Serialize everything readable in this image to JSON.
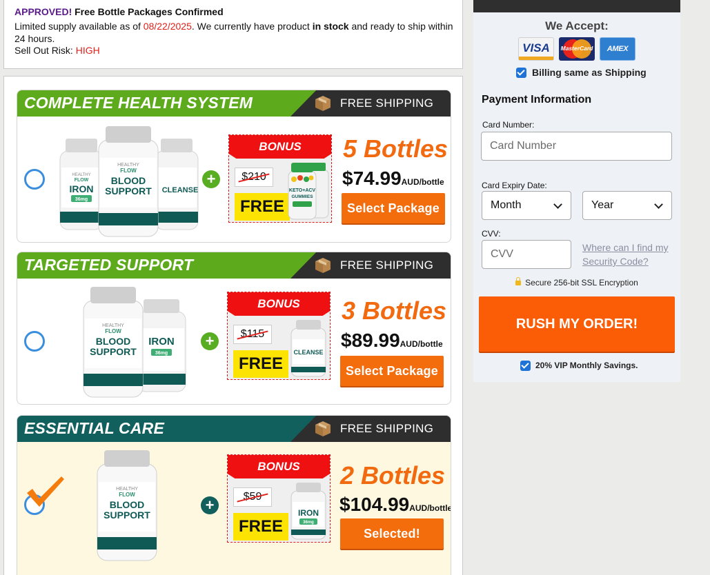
{
  "notice": {
    "approved": "APPROVED!",
    "headline": " Free Bottle Packages Confirmed",
    "supply_text": "Limited supply available as of ",
    "date": "08/22/2025",
    "after_date": ". We currently have product ",
    "in_stock": "in stock",
    "ship_text": " and ready to ship within 24 hours.",
    "risk_label": "Sell Out Risk: ",
    "risk_value": "HIGH"
  },
  "packages": [
    {
      "title": "COMPLETE HEALTH SYSTEM",
      "shipping": "FREE SHIPPING",
      "bonus_label": "BONUS",
      "bonus_old_price": "$210",
      "bonus_free": "FREE",
      "quantity": "5 Bottles",
      "price": "$74.99",
      "price_unit": "AUD/bottle",
      "button": "Select Package",
      "selected": false
    },
    {
      "title": "TARGETED SUPPORT",
      "shipping": "FREE SHIPPING",
      "bonus_label": "BONUS",
      "bonus_old_price": "$115",
      "bonus_free": "FREE",
      "quantity": "3 Bottles",
      "price": "$89.99",
      "price_unit": "AUD/bottle",
      "button": "Select Package",
      "selected": false
    },
    {
      "title": "ESSENTIAL CARE",
      "shipping": "FREE SHIPPING",
      "bonus_label": "BONUS",
      "bonus_old_price": "$59",
      "bonus_free": "FREE",
      "quantity": "2 Bottles",
      "price": "$104.99",
      "price_unit": "AUD/bottle",
      "button": "Selected!",
      "selected": true
    }
  ],
  "bottle_labels": {
    "brand_top": "HEALTHY",
    "brand": "FLOW",
    "iron": "IRON",
    "iron_sub": "36mg",
    "blood": "BLOOD",
    "support": "SUPPORT",
    "cleanse": "CLEANSE",
    "keto": "KETO+ACV",
    "gummies": "GUMMIES"
  },
  "payment": {
    "accept_title": "We Accept:",
    "cards": [
      "VISA",
      "MasterCard",
      "AMEX"
    ],
    "billing_same": "Billing same as Shipping",
    "billing_checked": true,
    "section_title": "Payment Information",
    "card_number_label": "Card Number:",
    "card_number_placeholder": "Card Number",
    "expiry_label": "Card Expiry Date:",
    "month": "Month",
    "year": "Year",
    "cvv_label": "CVV:",
    "cvv_placeholder": "CVV",
    "cvv_help": "Where can I find my Security Code?",
    "secure_text": "Secure 256-bit SSL Encryption",
    "rush_button": "RUSH MY ORDER!",
    "vip_text": "20% VIP Monthly Savings.",
    "vip_checked": true
  },
  "colors": {
    "green_header": "#5dab1d",
    "teal_header": "#11605e",
    "orange_button": "#f46d0d",
    "rush_button": "#fb5c06",
    "bonus_red": "#ef1111",
    "free_yellow": "#fde302",
    "quantity_orange": "#f26a10"
  }
}
